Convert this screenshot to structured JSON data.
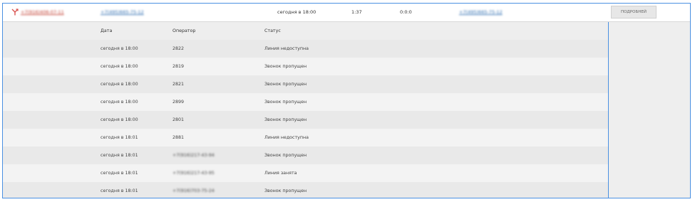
{
  "call": {
    "caller_number": "+7(916)406-07-11",
    "callee_number": "+7(495)665-75-12",
    "date": "сегодня в 18:00",
    "wait_time": "1:37",
    "talk_time": "0:0:0",
    "redirect_number": "+7(495)665-75-12",
    "details_button": "ПОДРОБНЕЙ"
  },
  "details": {
    "headers": {
      "date": "Дата",
      "operator": "Оператор",
      "status": "Статус"
    },
    "rows": [
      {
        "date": "сегодня в 18:00",
        "operator": "2822",
        "status": "Линия недоступна"
      },
      {
        "date": "сегодня в 18:00",
        "operator": "2819",
        "status": "Звонок пропущен"
      },
      {
        "date": "сегодня в 18:00",
        "operator": "2821",
        "status": "Звонок пропущен"
      },
      {
        "date": "сегодня в 18:00",
        "operator": "2899",
        "status": "Звонок пропущен"
      },
      {
        "date": "сегодня в 18:00",
        "operator": "2801",
        "status": "Звонок пропущен"
      },
      {
        "date": "сегодня в 18:01",
        "operator": "2881",
        "status": "Линия недоступна"
      },
      {
        "date": "сегодня в 18:01",
        "operator": "+7(916)217-43-94",
        "status": "Звонок пропущен"
      },
      {
        "date": "сегодня в 18:01",
        "operator": "+7(916)217-43-95",
        "status": "Линия занята"
      },
      {
        "date": "сегодня в 18:01",
        "operator": "+7(916)703-75-24",
        "status": "Звонок пропущен"
      }
    ]
  },
  "colors": {
    "accent": "#4a90e2",
    "missed_icon": "#d9534f"
  }
}
